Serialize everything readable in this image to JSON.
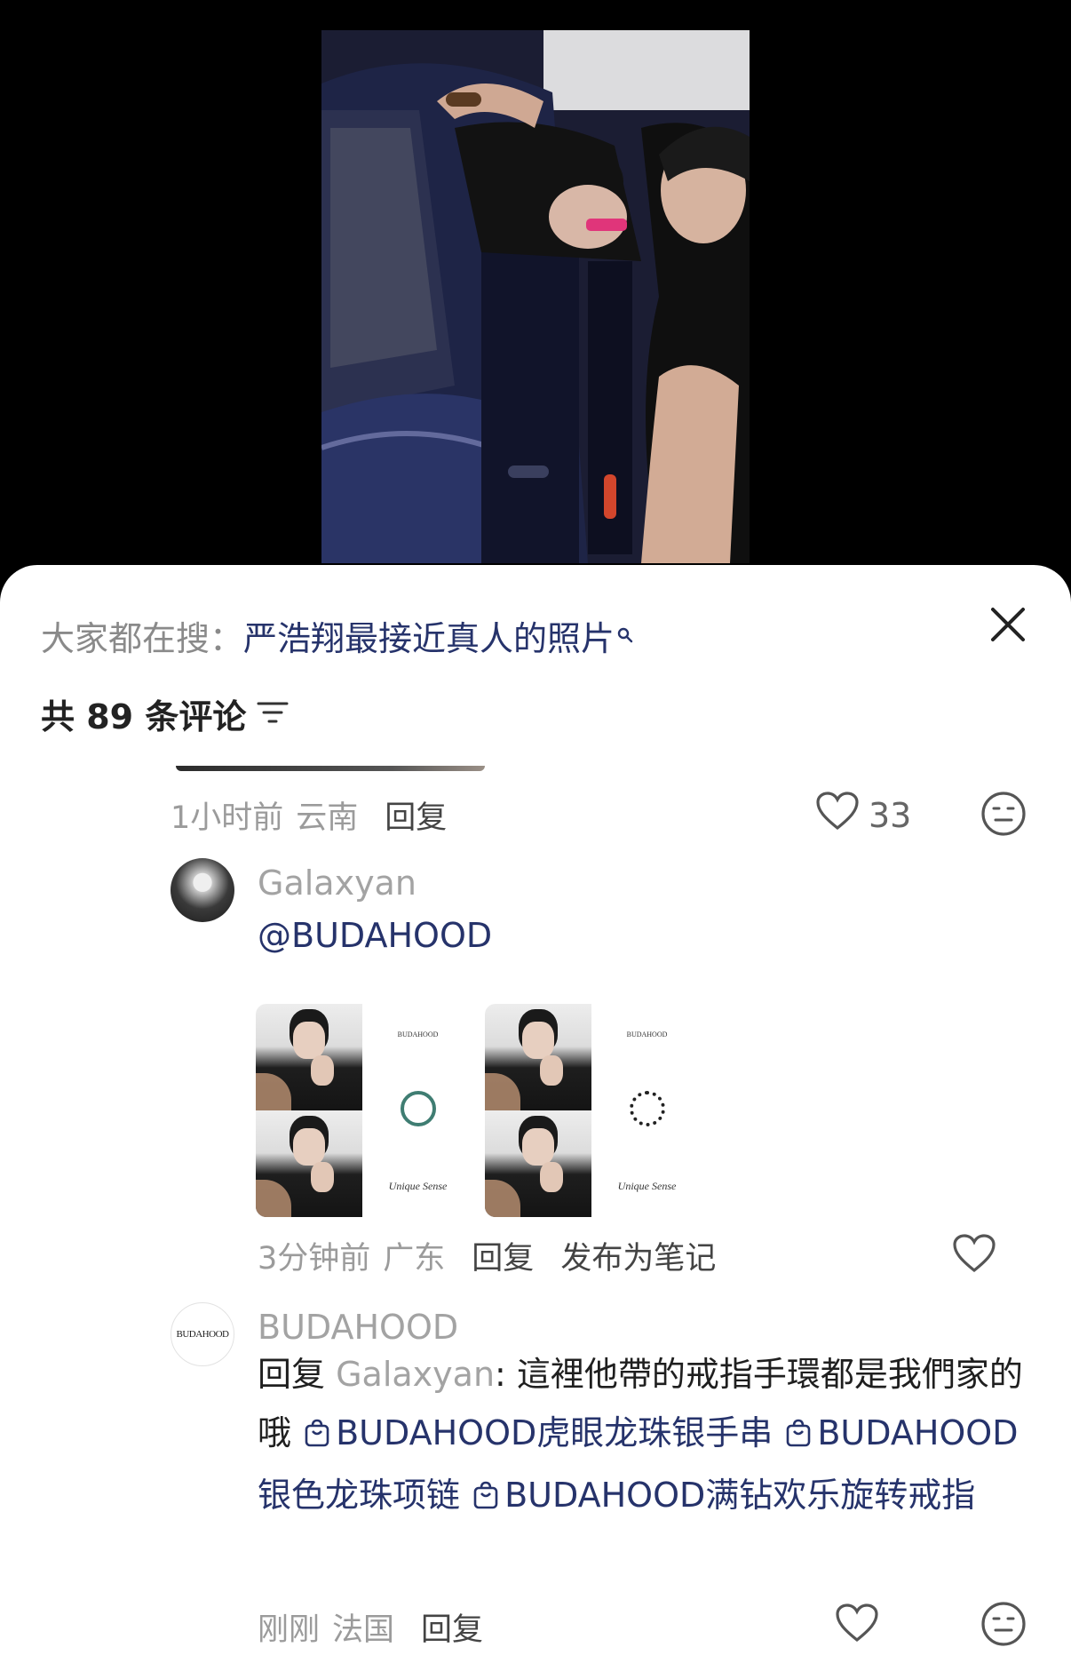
{
  "search": {
    "prefix": "大家都在搜：",
    "keyword": "严浩翔最接近真人的照片"
  },
  "comments_header": {
    "count_text": "共 89 条评论"
  },
  "comments": [
    {
      "time": "1小时前",
      "location": "云南",
      "reply_label": "回复",
      "likes": "33"
    },
    {
      "username": "Galaxyan",
      "text": "@BUDAHOOD",
      "images": [
        {
          "brand_top": "BUDAHOOD",
          "brand_bottom": "Unique Sense",
          "ring": "green"
        },
        {
          "brand_top": "BUDAHOOD",
          "brand_bottom": "Unique Sense",
          "ring": "black"
        }
      ],
      "time": "3分钟前",
      "location": "广东",
      "reply_label": "回复",
      "publish_label": "发布为笔记"
    },
    {
      "username": "BUDAHOOD",
      "avatar_text": "BUDAHOOD",
      "reply_prefix": "回复",
      "reply_to": "Galaxyan",
      "text_lead": ": 這裡他帶的戒指手環都是我們家的哦",
      "products": [
        "BUDAHOOD虎眼龙珠银手串",
        "BUDAHOOD银色龙珠项链",
        "BUDAHOOD满钻欢乐旋转戒指"
      ],
      "time": "刚刚",
      "location": "法国",
      "reply_label": "回复"
    }
  ]
}
